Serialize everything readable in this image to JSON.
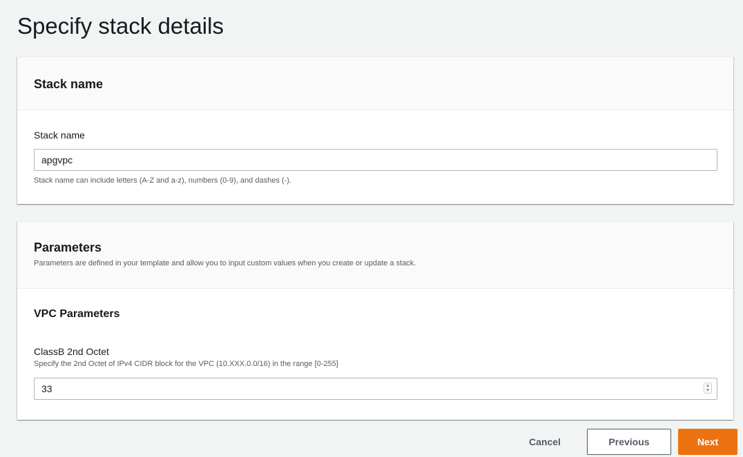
{
  "page": {
    "title": "Specify stack details"
  },
  "stack_name_section": {
    "heading": "Stack name",
    "field_label": "Stack name",
    "value": "apgvpc",
    "hint": "Stack name can include letters (A-Z and a-z), numbers (0-9), and dashes (-)."
  },
  "parameters_section": {
    "heading": "Parameters",
    "description": "Parameters are defined in your template and allow you to input custom values when you create or update a stack.",
    "group_heading": "VPC Parameters",
    "classb": {
      "label": "ClassB 2nd Octet",
      "description": "Specify the 2nd Octet of IPv4 CIDR block for the VPC (10.XXX.0.0/16) in the range [0-255]",
      "value": "33"
    }
  },
  "footer": {
    "cancel_label": "Cancel",
    "previous_label": "Previous",
    "next_label": "Next"
  },
  "colors": {
    "primary_button": "#ec7211",
    "page_background": "#f2f3f3",
    "panel_header_background": "#fafafa",
    "input_border": "#aab7b8"
  },
  "icons": {
    "stepper": "up-down-stepper-icon"
  }
}
